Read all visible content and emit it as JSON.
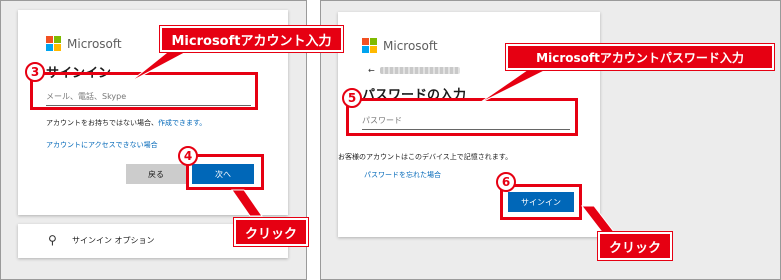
{
  "colors": {
    "accent_red": "#e60012",
    "ms_blue": "#0067b8",
    "ms_red": "#f25022",
    "ms_green": "#7fba00",
    "ms_blue_square": "#00a4ef",
    "ms_yellow": "#ffb900"
  },
  "left_dialog": {
    "brand": "Microsoft",
    "heading": "サインイン",
    "email_placeholder": "メール、電話、Skype",
    "no_account_text": "アカウントをお持ちではない場合、",
    "create_link": "作成できます。",
    "cant_access_link": "アカウントにアクセスできない場合",
    "back_button": "戻る",
    "next_button": "次へ",
    "options_label": "サインイン オプション",
    "options_icon": "key-icon"
  },
  "right_dialog": {
    "brand": "Microsoft",
    "back_icon": "back-arrow-icon",
    "heading": "パスワードの入力",
    "password_placeholder": "パスワード",
    "verify_text": "お客様のアカウントはこのデバイス上で記憶されます。",
    "forgot_link": "パスワードを忘れた場合",
    "signin_button": "サインイン"
  },
  "annotations": {
    "callout_account": "Microsoftアカウント入力",
    "callout_password": "Microsoftアカウントパスワード入力",
    "click_left": "クリック",
    "click_right": "クリック",
    "step3": "3",
    "step4": "4",
    "step5": "5",
    "step6": "6"
  }
}
